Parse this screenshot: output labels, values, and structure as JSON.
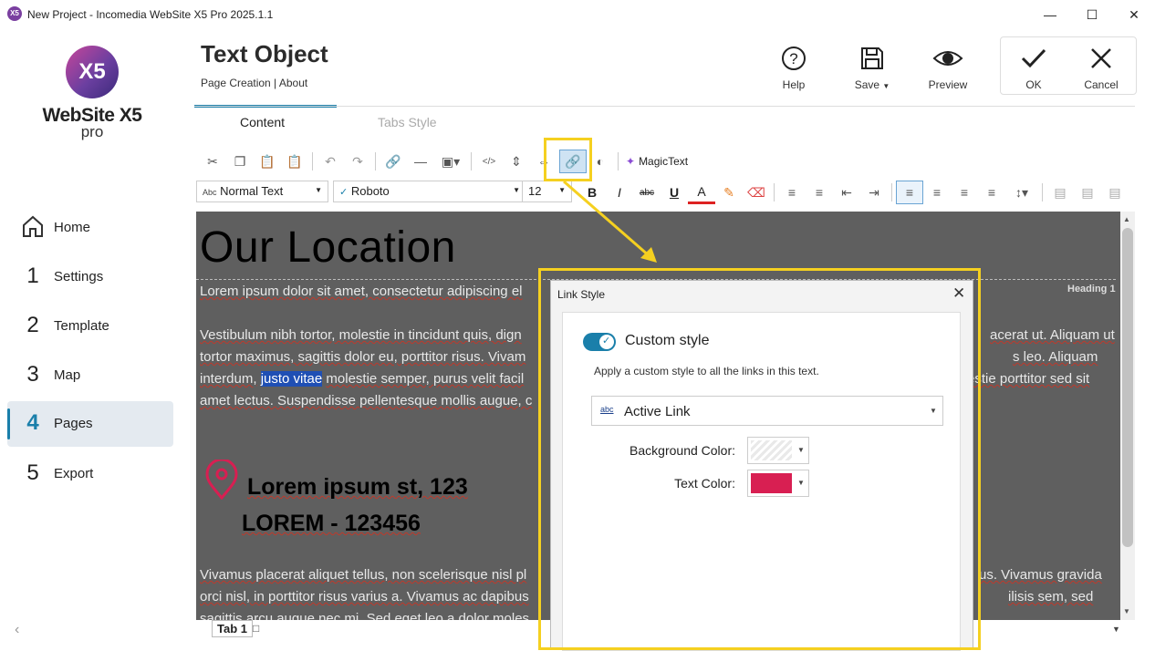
{
  "window": {
    "title": "New Project - Incomedia WebSite X5 Pro 2025.1.1",
    "icon_text": "X5"
  },
  "logo": {
    "mark": "X5",
    "name": "WebSite X5",
    "edition": "pro"
  },
  "nav": [
    {
      "num": "",
      "label": "Home"
    },
    {
      "num": "1",
      "label": "Settings"
    },
    {
      "num": "2",
      "label": "Template"
    },
    {
      "num": "3",
      "label": "Map"
    },
    {
      "num": "4",
      "label": "Pages"
    },
    {
      "num": "5",
      "label": "Export"
    }
  ],
  "header": {
    "title": "Text Object",
    "breadcrumb": "Page Creation | About"
  },
  "actions": {
    "help": "Help",
    "save": "Save",
    "preview": "Preview",
    "ok": "OK",
    "cancel": "Cancel"
  },
  "tabs": {
    "content": "Content",
    "tabs_style": "Tabs Style"
  },
  "toolbar": {
    "magictext": "MagicText",
    "style_icon": "Abc",
    "style": "Normal Text",
    "font": "Roboto",
    "size": "12",
    "bold": "B",
    "italic": "I",
    "strike": "abc",
    "underline": "U",
    "font_color_glyph": "A"
  },
  "editor": {
    "heading": "Our Location",
    "heading_tag": "Heading 1",
    "p1": "Lorem ipsum dolor sit amet, consectetur adipiscing el",
    "p2_l1": "Vestibulum nibh tortor, molestie in tincidunt quis, dign",
    "p2_l1r": "acerat ut. Aliquam ut",
    "p2_l2": "tortor maximus, sagittis dolor eu, porttitor risus. Vivam",
    "p2_l2r": "s leo. Aliquam",
    "p2_l3a": "interdum,",
    "p2_l3_link": "justo vitae",
    "p2_l3b": "molestie semper, purus velit facil",
    "p2_l3r": "estie porttitor sed sit",
    "p2_l4": "amet lectus. Suspendisse pellentesque mollis augue, c",
    "addr1": "Lorem ipsum st, 123",
    "addr2": "LOREM - 123456",
    "p3_l1": "Vivamus placerat aliquet tellus, non scelerisque nisl pl",
    "p3_l1r": "us. Vivamus gravida",
    "p3_l2": "orci nisl, in porttitor risus varius a. Vivamus ac dapibus",
    "p3_l2r": "ilisis sem, sed",
    "p3_l3": "sagittis arcu augue nec mi. Sed eget leo a dolor moles"
  },
  "bottom": {
    "tab": "Tab 1"
  },
  "dialog": {
    "title": "Link Style",
    "toggle_label": "Custom style",
    "toggle_on": true,
    "description": "Apply a custom style to all the links in this text.",
    "dropdown_icon": "abc",
    "dropdown_value": "Active Link",
    "bg_color_label": "Background Color:",
    "text_color_label": "Text Color:",
    "text_color": "#d81f52"
  },
  "colors": {
    "accent": "#1a7faa",
    "highlight": "#f5d020",
    "link_pin": "#d81f52"
  }
}
